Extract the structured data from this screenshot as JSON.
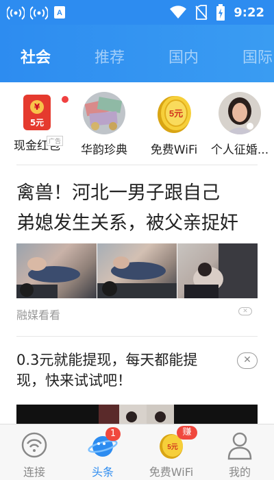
{
  "status_bar": {
    "time": "9:22",
    "icons": [
      "wifi-hotspot-icon",
      "wifi-hotspot-icon",
      "app-notification-icon",
      "wifi-icon",
      "no-sim-icon",
      "battery-charging-icon"
    ]
  },
  "tabs": [
    {
      "label": "社会",
      "active": true
    },
    {
      "label": "推荐",
      "active": false
    },
    {
      "label": "国内",
      "active": false
    },
    {
      "label": "国际",
      "active": false
    }
  ],
  "quick_links": [
    {
      "label": "现金红包",
      "icon": "red-envelope-icon",
      "badge_amount": "5元",
      "ad_tag": "广告"
    },
    {
      "label": "华韵珍典",
      "icon": "coins-collection-icon"
    },
    {
      "label": "免费WiFi",
      "icon": "gold-coin-icon",
      "coin_text": "5元"
    },
    {
      "label": "个人征婚...",
      "icon": "avatar-woman-icon"
    }
  ],
  "articles": [
    {
      "title": "禽兽！河北一男子跟自己\n弟媳发生关系，被父亲捉奸",
      "source": "融媒看看"
    },
    {
      "title": "0.3元就能提现，每天都能提\n现，快来试试吧！"
    }
  ],
  "bottom_nav": [
    {
      "label": "连接",
      "icon": "wifi-connect-icon",
      "active": false
    },
    {
      "label": "头条",
      "icon": "headline-planet-icon",
      "active": true,
      "badge": "1"
    },
    {
      "label": "免费WiFi",
      "icon": "gold-coin-icon",
      "active": false,
      "badge": "赚",
      "coin_text": "5元"
    },
    {
      "label": "我的",
      "icon": "person-icon",
      "active": false
    }
  ],
  "colors": {
    "accent": "#2d8cf0",
    "badge_red": "#f0483e"
  }
}
